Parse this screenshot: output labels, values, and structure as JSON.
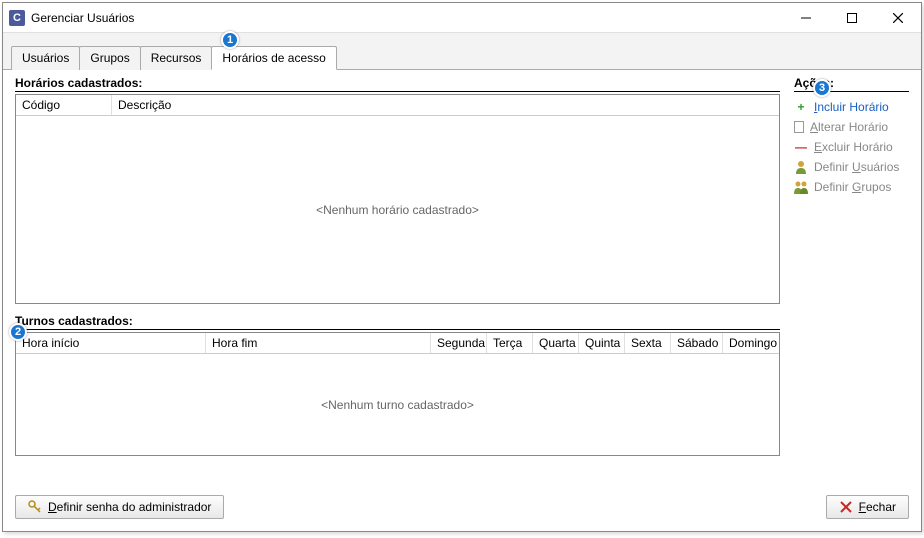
{
  "window": {
    "title": "Gerenciar Usuários",
    "app_icon_letter": "C"
  },
  "tabs": {
    "usuarios": "Usuários",
    "grupos": "Grupos",
    "recursos": "Recursos",
    "horarios": "Horários de acesso"
  },
  "sections": {
    "horarios_title": "Horários cadastrados:",
    "turnos_title": "Turnos cadastrados:",
    "acoes_title": "Ações:"
  },
  "horarios_grid": {
    "col_codigo": "Código",
    "col_descricao": "Descrição",
    "empty": "<Nenhum horário cadastrado>"
  },
  "turnos_grid": {
    "col_hora_inicio": "Hora início",
    "col_hora_fim": "Hora fim",
    "col_segunda": "Segunda",
    "col_terca": "Terça",
    "col_quarta": "Quarta",
    "col_quinta": "Quinta",
    "col_sexta": "Sexta",
    "col_sabado": "Sábado",
    "col_domingo": "Domingo",
    "empty": "<Nenhum turno cadastrado>"
  },
  "actions": {
    "incluir": {
      "pre": "",
      "mn": "I",
      "post": "ncluir Horário"
    },
    "alterar": {
      "pre": "",
      "mn": "A",
      "post": "lterar Horário"
    },
    "excluir": {
      "pre": "",
      "mn": "E",
      "post": "xcluir Horário"
    },
    "def_usuarios": {
      "pre": "Definir ",
      "mn": "U",
      "post": "suários"
    },
    "def_grupos": {
      "pre": "Definir ",
      "mn": "G",
      "post": "rupos"
    }
  },
  "footer": {
    "admin_btn": {
      "pre": "",
      "mn": "D",
      "post": "efinir senha do administrador"
    },
    "fechar_btn": {
      "pre": "",
      "mn": "F",
      "post": "echar"
    }
  },
  "callouts": {
    "one": "1",
    "two": "2",
    "three": "3"
  }
}
